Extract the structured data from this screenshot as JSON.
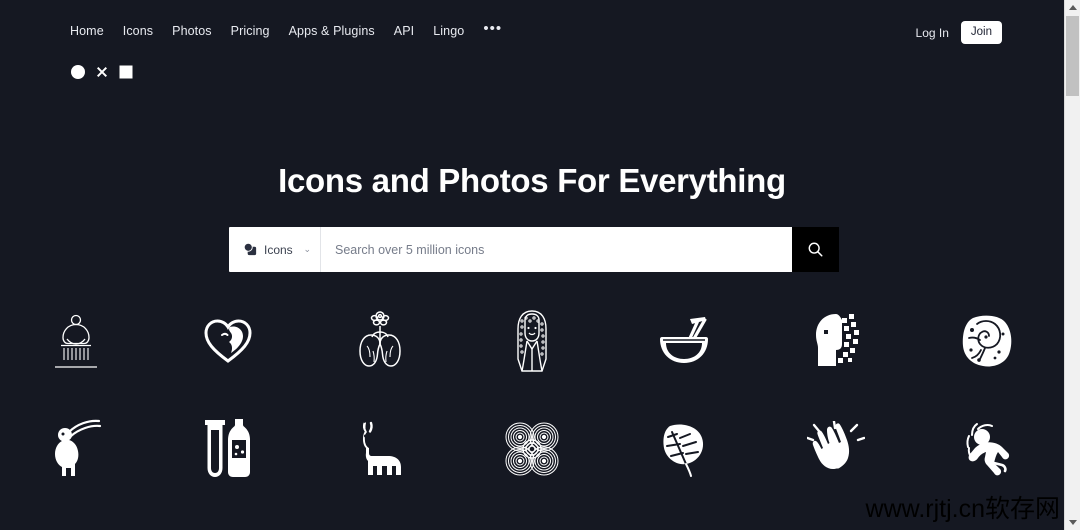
{
  "site": {
    "background_color": "#151822",
    "text_color": "#e8eaf0"
  },
  "nav": {
    "items": [
      {
        "label": "Home",
        "name": "nav-home"
      },
      {
        "label": "Icons",
        "name": "nav-icons"
      },
      {
        "label": "Photos",
        "name": "nav-photos"
      },
      {
        "label": "Pricing",
        "name": "nav-pricing"
      },
      {
        "label": "Apps & Plugins",
        "name": "nav-apps-plugins"
      },
      {
        "label": "API",
        "name": "nav-api"
      },
      {
        "label": "Lingo",
        "name": "nav-lingo"
      },
      {
        "label": "•••",
        "name": "nav-more"
      }
    ],
    "login_label": "Log In",
    "join_label": "Join",
    "join_bg": "#ffffff",
    "join_text_color": "#1c2030"
  },
  "shapes_row": [
    {
      "name": "circle-shape-icon",
      "shape": "circle"
    },
    {
      "name": "close-x-icon",
      "shape": "x"
    },
    {
      "name": "square-shape-icon",
      "shape": "square"
    }
  ],
  "hero": {
    "title": "Icons and Photos For Everything"
  },
  "search": {
    "type_label": "Icons",
    "type_icon": "shapes-icon",
    "chevron": "⌄",
    "placeholder": "Search over 5 million icons",
    "value": "",
    "button_icon": "search-icon",
    "button_bg": "#000000"
  },
  "icon_grid": {
    "row1": [
      {
        "name": "meditation-shower-icon",
        "label": "Meditating figure"
      },
      {
        "name": "heart-face-icon",
        "label": "Heart with face"
      },
      {
        "name": "lungs-flower-icon",
        "label": "Lungs with flower"
      },
      {
        "name": "woman-long-hair-icon",
        "label": "Woman with long hair"
      },
      {
        "name": "noodle-bowl-icon",
        "label": "Noodle bowl with chopsticks"
      },
      {
        "name": "pixelated-head-icon",
        "label": "Pixelated head profile"
      },
      {
        "name": "ammonite-fossil-icon",
        "label": "Ammonite fossil"
      }
    ],
    "row2": [
      {
        "name": "goat-icon",
        "label": "Goat"
      },
      {
        "name": "test-tube-bottle-icon",
        "label": "Test tube and bottle"
      },
      {
        "name": "llama-icon",
        "label": "Llama"
      },
      {
        "name": "spiral-pattern-icon",
        "label": "Concentric spiral pattern"
      },
      {
        "name": "monstera-leaf-icon",
        "label": "Monstera leaf"
      },
      {
        "name": "clapping-hands-icon",
        "label": "Clapping hands"
      },
      {
        "name": "stretching-person-icon",
        "label": "Person stretching"
      }
    ]
  },
  "watermark": {
    "text": "www.rjtj.cn软存网"
  },
  "scrollbar": {
    "up_arrow": "▲",
    "down_arrow": "▼"
  }
}
